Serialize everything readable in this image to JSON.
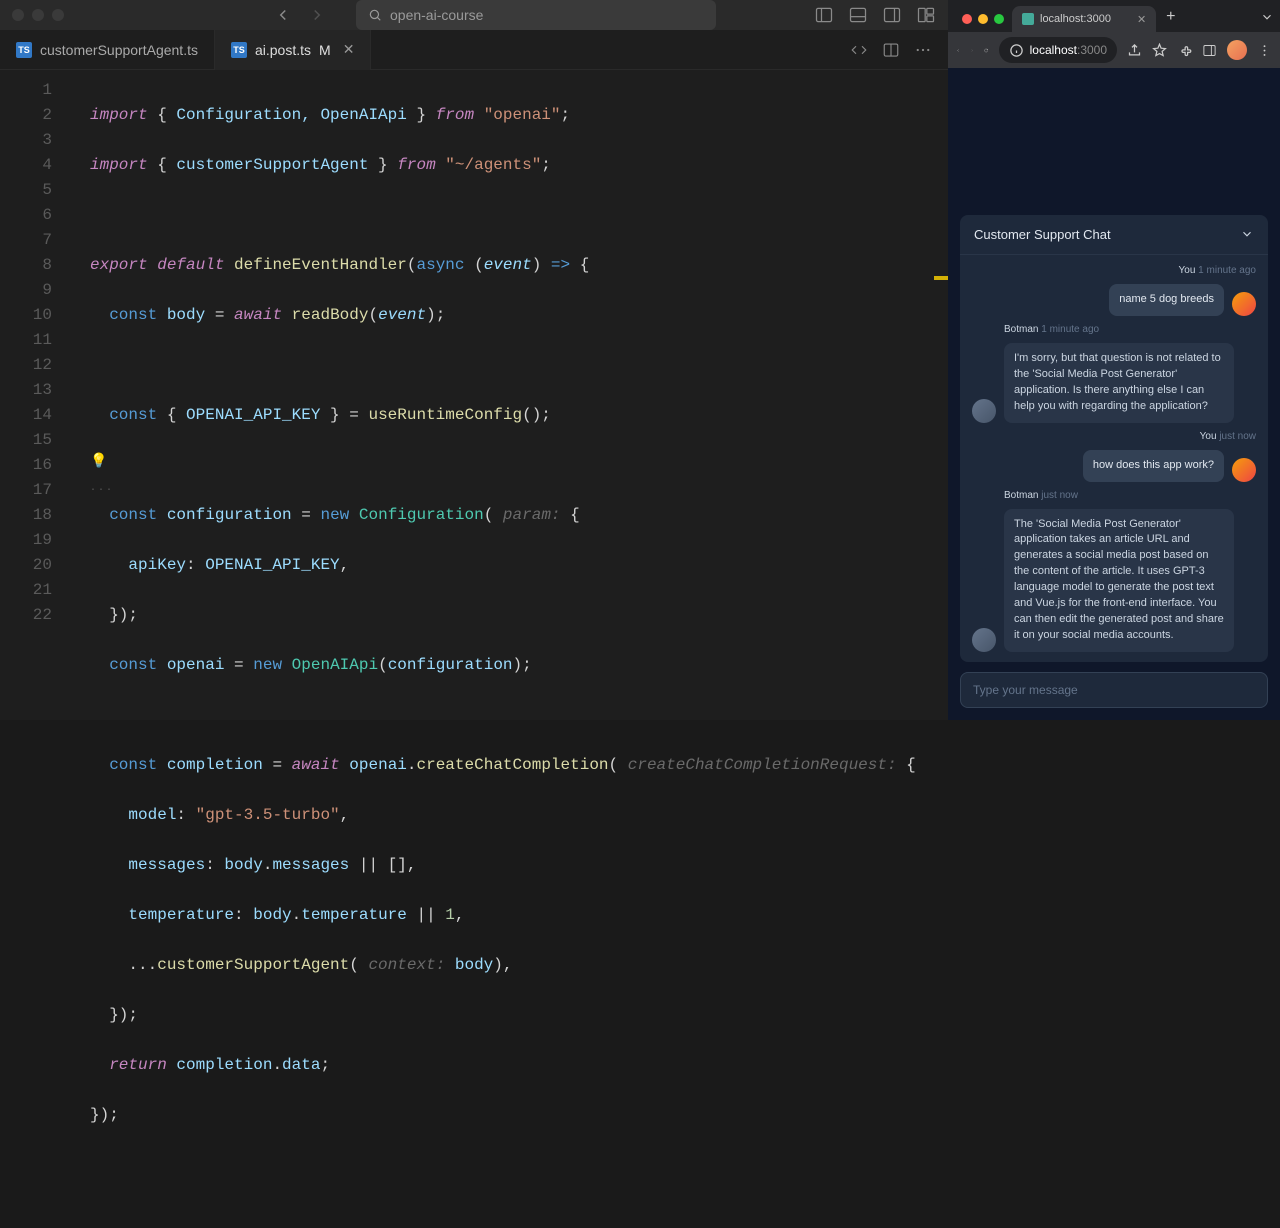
{
  "editor": {
    "search_text": "open-ai-course",
    "tabs": [
      {
        "label": "customerSupportAgent.ts",
        "active": false,
        "modified": ""
      },
      {
        "label": "ai.post.ts",
        "active": true,
        "modified": "M"
      }
    ],
    "lines": [
      1,
      2,
      3,
      4,
      5,
      6,
      7,
      8,
      9,
      10,
      11,
      12,
      13,
      14,
      15,
      16,
      17,
      18,
      19,
      20,
      21,
      22
    ],
    "code": {
      "l1_kw_import": "import",
      "l1_kw_from": "from",
      "l1_ids": "Configuration, OpenAIApi",
      "l1_str": "\"openai\"",
      "l2_id": "customerSupportAgent",
      "l2_str": "\"~/agents\"",
      "l4_export": "export",
      "l4_default": "default",
      "l4_fn": "defineEventHandler",
      "l4_async": "async",
      "l4_event": "event",
      "l5_const": "const",
      "l5_body": "body",
      "l5_await": "await",
      "l5_readBody": "readBody",
      "l7_key": "OPENAI_API_KEY",
      "l7_useRC": "useRuntimeConfig",
      "l9_conf": "configuration",
      "l9_new": "new",
      "l9_Configuration": "Configuration",
      "l9_hint": "param:",
      "l10_apiKey": "apiKey",
      "l12_openai": "openai",
      "l12_OpenAIApi": "OpenAIApi",
      "l14_completion": "completion",
      "l14_ccc": "createChatCompletion",
      "l14_hint": "createChatCompletionRequest:",
      "l15_model": "model",
      "l15_modelval": "\"gpt-3.5-turbo\"",
      "l16_messages": "messages",
      "l17_temperature": "temperature",
      "l17_one": "1",
      "l18_csa": "customerSupportAgent",
      "l18_hint": "context:",
      "l20_return": "return",
      "l20_data": "data"
    }
  },
  "browser": {
    "tab_title": "localhost:3000",
    "url_domain": "localhost",
    "url_port": ":3000"
  },
  "chat": {
    "title": "Customer Support Chat",
    "messages": [
      {
        "who": "You",
        "time": "1 minute ago",
        "side": "user",
        "text": "name 5 dog breeds"
      },
      {
        "who": "Botman",
        "time": "1 minute ago",
        "side": "bot",
        "text": "I'm sorry, but that question is not related to the 'Social Media Post Generator' application. Is there anything else I can help you with regarding the application?"
      },
      {
        "who": "You",
        "time": "just now",
        "side": "user",
        "text": "how does this app work?"
      },
      {
        "who": "Botman",
        "time": "just now",
        "side": "bot",
        "text": "The 'Social Media Post Generator' application takes an article URL and generates a social media post based on the content of the article. It uses GPT-3 language model to generate the post text and Vue.js for the front-end interface. You can then edit the generated post and share it on your social media accounts."
      }
    ],
    "input_placeholder": "Type your message"
  }
}
